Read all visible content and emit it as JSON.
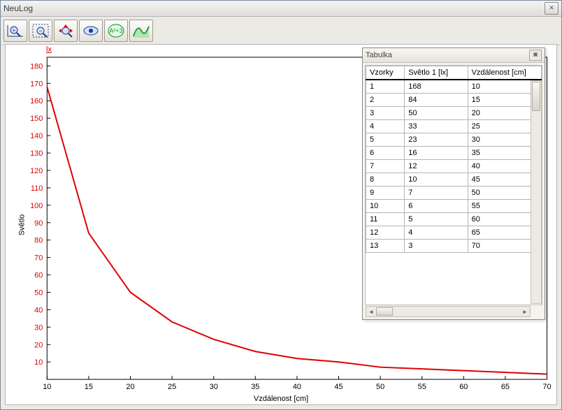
{
  "window": {
    "title": "NeuLog"
  },
  "toolbar": {
    "icons": [
      "zoom-in-icon",
      "zoom-out-icon",
      "fit-icon",
      "eye-icon",
      "formula-icon",
      "curve-icon"
    ]
  },
  "chart_data": {
    "type": "line",
    "x": [
      10,
      15,
      20,
      25,
      30,
      35,
      40,
      45,
      50,
      55,
      60,
      65,
      70
    ],
    "values": [
      168,
      84,
      50,
      33,
      23,
      16,
      12,
      10,
      7,
      6,
      5,
      4,
      3
    ],
    "series_name": "Světlo 1",
    "unit": "lx",
    "xlabel": "Vzdálenost [cm]",
    "ylabel": "Světlo",
    "xlim": [
      10,
      70
    ],
    "ylim": [
      0,
      185
    ],
    "xticks": [
      10,
      15,
      20,
      25,
      30,
      35,
      40,
      45,
      50,
      55,
      60,
      65,
      70
    ],
    "yticks": [
      10,
      20,
      30,
      40,
      50,
      60,
      70,
      80,
      90,
      100,
      110,
      120,
      130,
      140,
      150,
      160,
      170,
      180
    ],
    "color": "#e00000"
  },
  "table": {
    "title": "Tabulka",
    "headers": [
      "Vzorky",
      "Světlo 1 [lx]",
      "Vzdálenost [cm]"
    ],
    "rows": [
      [
        "1",
        "168",
        "10"
      ],
      [
        "2",
        "84",
        "15"
      ],
      [
        "3",
        "50",
        "20"
      ],
      [
        "4",
        "33",
        "25"
      ],
      [
        "5",
        "23",
        "30"
      ],
      [
        "6",
        "16",
        "35"
      ],
      [
        "7",
        "12",
        "40"
      ],
      [
        "8",
        "10",
        "45"
      ],
      [
        "9",
        "7",
        "50"
      ],
      [
        "10",
        "6",
        "55"
      ],
      [
        "11",
        "5",
        "60"
      ],
      [
        "12",
        "4",
        "65"
      ],
      [
        "13",
        "3",
        "70"
      ]
    ]
  }
}
